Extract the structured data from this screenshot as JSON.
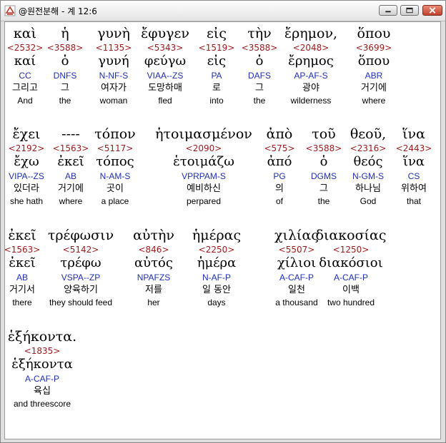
{
  "window": {
    "title": "@원전분해 - 계 12:6",
    "buttons": {
      "minimize": "minimize-icon",
      "maximize": "maximize-icon",
      "close": "close-icon"
    }
  },
  "words": [
    {
      "g": "καὶ",
      "s": "<2532>",
      "l": "καί",
      "p": "CC",
      "k": "그리고",
      "e": "And"
    },
    {
      "g": "ἡ",
      "s": "<3588>",
      "l": "ὁ",
      "p": "DNFS",
      "k": "그",
      "e": "the"
    },
    {
      "g": "γυνὴ",
      "s": "<1135>",
      "l": "γυνή",
      "p": "N-NF-S",
      "k": "여자가",
      "e": "woman"
    },
    {
      "g": "ἔφυγεν",
      "s": "<5343>",
      "l": "φεύγω",
      "p": "VIAA--ZS",
      "k": "도망하매",
      "e": "fled"
    },
    {
      "g": "εἰς",
      "s": "<1519>",
      "l": "εἰς",
      "p": "PA",
      "k": "로",
      "e": "into"
    },
    {
      "g": "τὴν",
      "s": "<3588>",
      "l": "ὁ",
      "p": "DAFS",
      "k": "그",
      "e": "the"
    },
    {
      "g": "ἔρημον,",
      "s": "<2048>",
      "l": "ἔρημος",
      "p": "AP-AF-S",
      "k": "광야",
      "e": "wilderness"
    },
    {
      "g": "ὅπου",
      "s": "<3699>",
      "l": "ὅπου",
      "p": "ABR",
      "k": "거기에",
      "e": "where"
    },
    {
      "g": "ἔχει",
      "s": "<2192>",
      "l": "ἔχω",
      "p": "VIPA--ZS",
      "k": "있더라",
      "e": "she hath"
    },
    {
      "g": "----",
      "s": "<1563>",
      "l": "ἐκεῖ",
      "p": "AB",
      "k": "거기에",
      "e": "where"
    },
    {
      "g": "τόπον",
      "s": "<5117>",
      "l": "τόπος",
      "p": "N-AM-S",
      "k": "곳이",
      "e": "a place"
    },
    {
      "g": "ἡτοιμασμένον",
      "s": "<2090>",
      "l": "ἑτοιμάζω",
      "p": "VPRPAM-S",
      "k": "예비하신",
      "e": "perpared"
    },
    {
      "g": "ἀπὸ",
      "s": "<575>",
      "l": "ἀπό",
      "p": "PG",
      "k": "의",
      "e": "of"
    },
    {
      "g": "τοῦ",
      "s": "<3588>",
      "l": "ὁ",
      "p": "DGMS",
      "k": "그",
      "e": "the"
    },
    {
      "g": "θεοῦ,",
      "s": "<2316>",
      "l": "θεός",
      "p": "N-GM-S",
      "k": "하나님",
      "e": "God"
    },
    {
      "g": "ἵνα",
      "s": "<2443>",
      "l": "ἵνα",
      "p": "CS",
      "k": "위하여",
      "e": "that"
    },
    {
      "g": "ἐκεῖ",
      "s": "<1563>",
      "l": "ἐκεῖ",
      "p": "AB",
      "k": "거기서",
      "e": "there"
    },
    {
      "g": "τρέφωσιν",
      "s": "<5142>",
      "l": "τρέφω",
      "p": "VSPA--ZP",
      "k": "양육하기",
      "e": "they should feed"
    },
    {
      "g": "αὐτὴν",
      "s": "<846>",
      "l": "αὐτός",
      "p": "NPAFZS",
      "k": "저를",
      "e": "her"
    },
    {
      "g": "ἡμέρας",
      "s": "<2250>",
      "l": "ἡμέρα",
      "p": "N-AF-P",
      "k": "일 동안",
      "e": "days"
    },
    {
      "g": "χιλίας",
      "s": "<5507>",
      "l": "χίλιοι",
      "p": "A-CAF-P",
      "k": "일천",
      "e": "a thousand"
    },
    {
      "g": "διακοσίας",
      "s": "<1250>",
      "l": "διακόσιοι",
      "p": "A-CAF-P",
      "k": "이백",
      "e": "two hundred"
    },
    {
      "g": "ἑξήκοντα.",
      "s": "<1835>",
      "l": "ἑξήκοντα",
      "p": "A-CAF-P",
      "k": "육십",
      "e": "and threescore"
    }
  ]
}
